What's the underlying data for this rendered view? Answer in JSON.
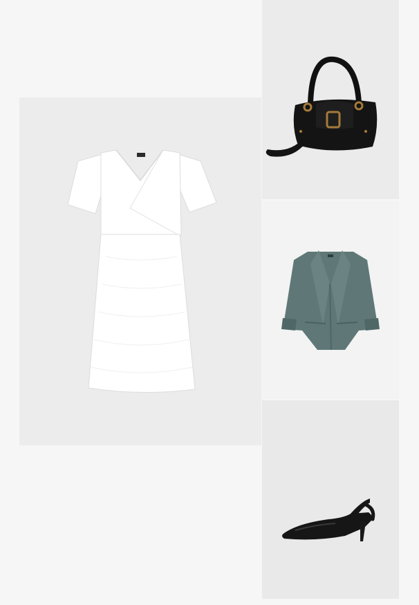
{
  "outfit": {
    "background_color": "#f6f6f6",
    "items": [
      {
        "key": "dress",
        "icon": "white-dress-icon",
        "tile_color": "#ececec",
        "item_color": "#ffffff"
      },
      {
        "key": "bag",
        "icon": "black-handbag-icon",
        "tile_color": "#ebebeb",
        "item_color": "#111111"
      },
      {
        "key": "blazer",
        "icon": "teal-blazer-icon",
        "tile_color": "#f3f3f3",
        "item_color": "#5f7877"
      },
      {
        "key": "shoe",
        "icon": "black-slingback-pump-icon",
        "tile_color": "#e9e9e9",
        "item_color": "#161616"
      }
    ]
  }
}
